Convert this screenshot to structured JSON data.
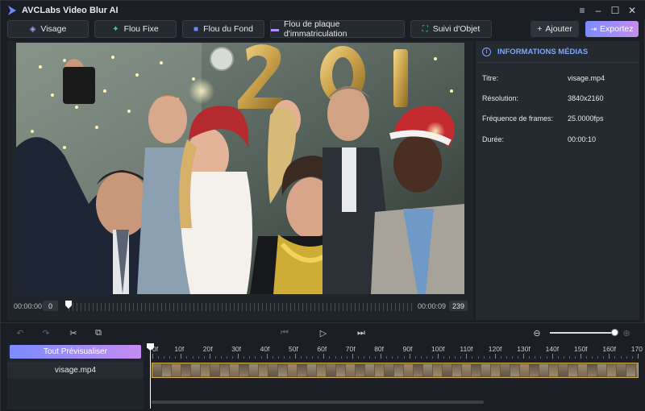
{
  "app": {
    "title": "AVCLabs Video Blur AI"
  },
  "window_controls": {
    "menu": "≡",
    "minimize": "–",
    "maximize": "☐",
    "close": "✕"
  },
  "toolbar": {
    "tabs": [
      {
        "label": "Visage",
        "icon": "face-icon"
      },
      {
        "label": "Flou Fixe",
        "icon": "fixed-blur-icon"
      },
      {
        "label": "Flou du Fond",
        "icon": "background-blur-icon"
      },
      {
        "label": "Flou de plaque d'immatriculation",
        "icon": "license-plate-icon"
      },
      {
        "label": "Suivi d'Objet",
        "icon": "object-tracking-icon"
      }
    ],
    "add_label": "Ajouter",
    "export_label": "Exportez"
  },
  "preview": {
    "time_start": "00:00:00",
    "frame_start": "0",
    "time_end": "00:00:09",
    "frame_end": "239"
  },
  "media_info": {
    "header": "INFORMATIONS MÉDIAS",
    "rows": [
      {
        "label": "Titre:",
        "value": "visage.mp4"
      },
      {
        "label": "Résolution:",
        "value": "3840x2160"
      },
      {
        "label": "Fréquence de frames:",
        "value": "25.0000fps"
      },
      {
        "label": "Durée:",
        "value": "00:00:10"
      }
    ]
  },
  "timeline": {
    "preview_all_label": "Tout Prévisualiser",
    "file_name": "visage.mp4",
    "ruler_labels": [
      "0f",
      "10f",
      "20f",
      "30f",
      "40f",
      "50f",
      "60f",
      "70f",
      "80f",
      "90f",
      "100f",
      "110f",
      "120f",
      "130f",
      "140f",
      "150f",
      "160f",
      "170"
    ],
    "zoom_level": 1.0
  },
  "colors": {
    "accent_gradient_start": "#7a8cff",
    "accent_gradient_end": "#c48cf0",
    "info_accent": "#7aa7ff",
    "track_border": "#d8b24a"
  }
}
